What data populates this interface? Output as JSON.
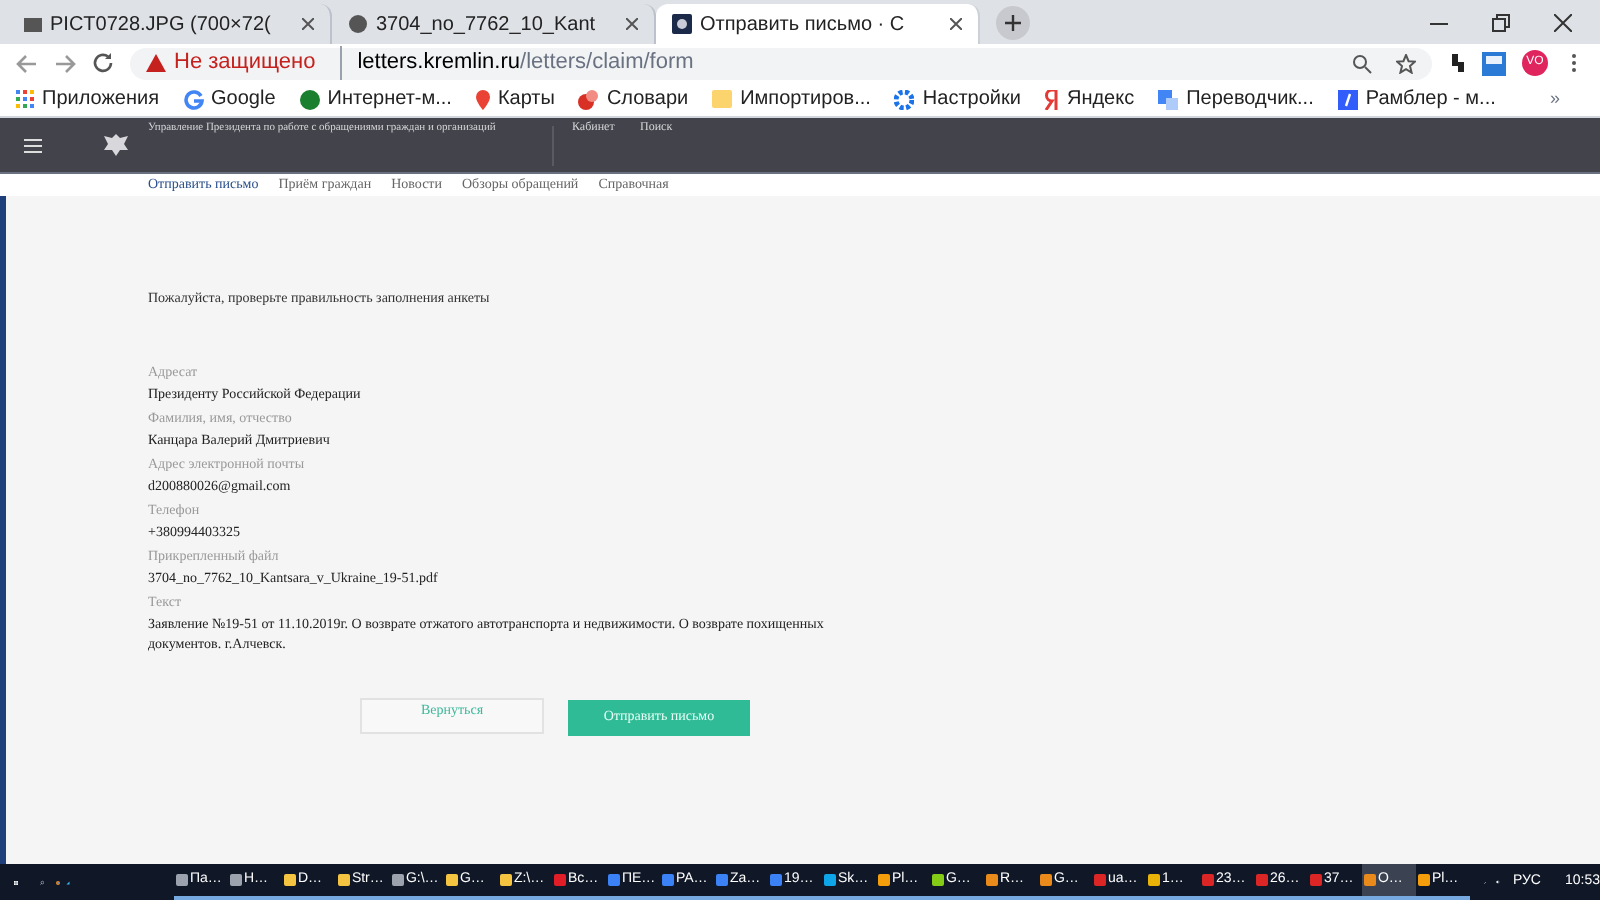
{
  "browser": {
    "tabs": [
      {
        "title": "PICT0728.JPG (700×72(",
        "selected": false
      },
      {
        "title": "3704_no_7762_10_Kant",
        "selected": false
      },
      {
        "title": "Отправить письмо · С",
        "selected": true
      }
    ],
    "address": {
      "security": "Не защищено",
      "host": "letters.kremlin.ru",
      "path": "/letters/claim/form"
    },
    "profile": "VO",
    "bookmarks": [
      "Приложения",
      "Google",
      "Интернет-м...",
      "Карты",
      "Словари",
      "Импортиров...",
      "Настройки",
      "Яндекс",
      "Переводчик...",
      "Рамблер - м..."
    ],
    "more": "»"
  },
  "site": {
    "title": "Управление Президента по работе с обращениями граждан и организаций",
    "top_links": [
      "Кабинет",
      "Поиск"
    ],
    "nav": [
      {
        "label": "Отправить письмо",
        "selected": true
      },
      {
        "label": "Приём граждан",
        "selected": false
      },
      {
        "label": "Новости",
        "selected": false
      },
      {
        "label": "Обзоры обращений",
        "selected": false
      },
      {
        "label": "Справочная",
        "selected": false
      }
    ],
    "intro": "Пожалуйста, проверьте правильность заполнения анкеты",
    "fields": [
      {
        "label": "Адресат",
        "value": "Президенту Российской Федерации"
      },
      {
        "label": "Фамилия, имя, отчество",
        "value": "Канцара Валерий Дмитриевич"
      },
      {
        "label": "Адрес электронной почты",
        "value": "d200880026@gmail.com"
      },
      {
        "label": "Телефон",
        "value": "+380994403325"
      },
      {
        "label": "Прикрепленный файл",
        "value": "3704_no_7762_10_Kantsara_v_Ukraine_19-51.pdf"
      },
      {
        "label": "Текст",
        "value": "Заявление №19-51 от 11.10.2019г. О возврате отжатого автотранспорта и недвижимости. О возврате похищенных документов. г.Алчевск."
      }
    ],
    "back_button": "Вернуться",
    "send_button": "Отправить письмо"
  },
  "taskbar": {
    "apps": [
      {
        "label": "Па…",
        "color": "#9ca3af",
        "selected": false
      },
      {
        "label": "H…",
        "color": "#9ca3af",
        "selected": false
      },
      {
        "label": "D…",
        "color": "#f5c542",
        "selected": false
      },
      {
        "label": "Str…",
        "color": "#f5c542",
        "selected": false
      },
      {
        "label": "G:\\…",
        "color": "#9ca3af",
        "selected": false
      },
      {
        "label": "G…",
        "color": "#f5c542",
        "selected": false
      },
      {
        "label": "Z:\\…",
        "color": "#f5c542",
        "selected": false
      },
      {
        "label": "Вс…",
        "color": "#e11d28",
        "selected": false
      },
      {
        "label": "ПЕ…",
        "color": "#3b82f6",
        "selected": false
      },
      {
        "label": "PA…",
        "color": "#3b82f6",
        "selected": false
      },
      {
        "label": "Za…",
        "color": "#3b82f6",
        "selected": false
      },
      {
        "label": "19…",
        "color": "#3b82f6",
        "selected": false
      },
      {
        "label": "Sk…",
        "color": "#0ea5e9",
        "selected": false
      },
      {
        "label": "Pl…",
        "color": "#f59e0b",
        "selected": false
      },
      {
        "label": "G…",
        "color": "#84cc16",
        "selected": false
      },
      {
        "label": "R…",
        "color": "#ea8a1a",
        "selected": false
      },
      {
        "label": "G…",
        "color": "#ea8a1a",
        "selected": false
      },
      {
        "label": "ua…",
        "color": "#dc2626",
        "selected": false
      },
      {
        "label": "1…",
        "color": "#eab308",
        "selected": false
      },
      {
        "label": "23…",
        "color": "#dc2626",
        "selected": false
      },
      {
        "label": "26…",
        "color": "#dc2626",
        "selected": false
      },
      {
        "label": "37…",
        "color": "#dc2626",
        "selected": false
      },
      {
        "label": "O…",
        "color": "#ea8a1a",
        "selected": true
      },
      {
        "label": "Pl…",
        "color": "#f59e0b",
        "selected": false
      }
    ],
    "language": "РУС",
    "time": "10:53"
  }
}
